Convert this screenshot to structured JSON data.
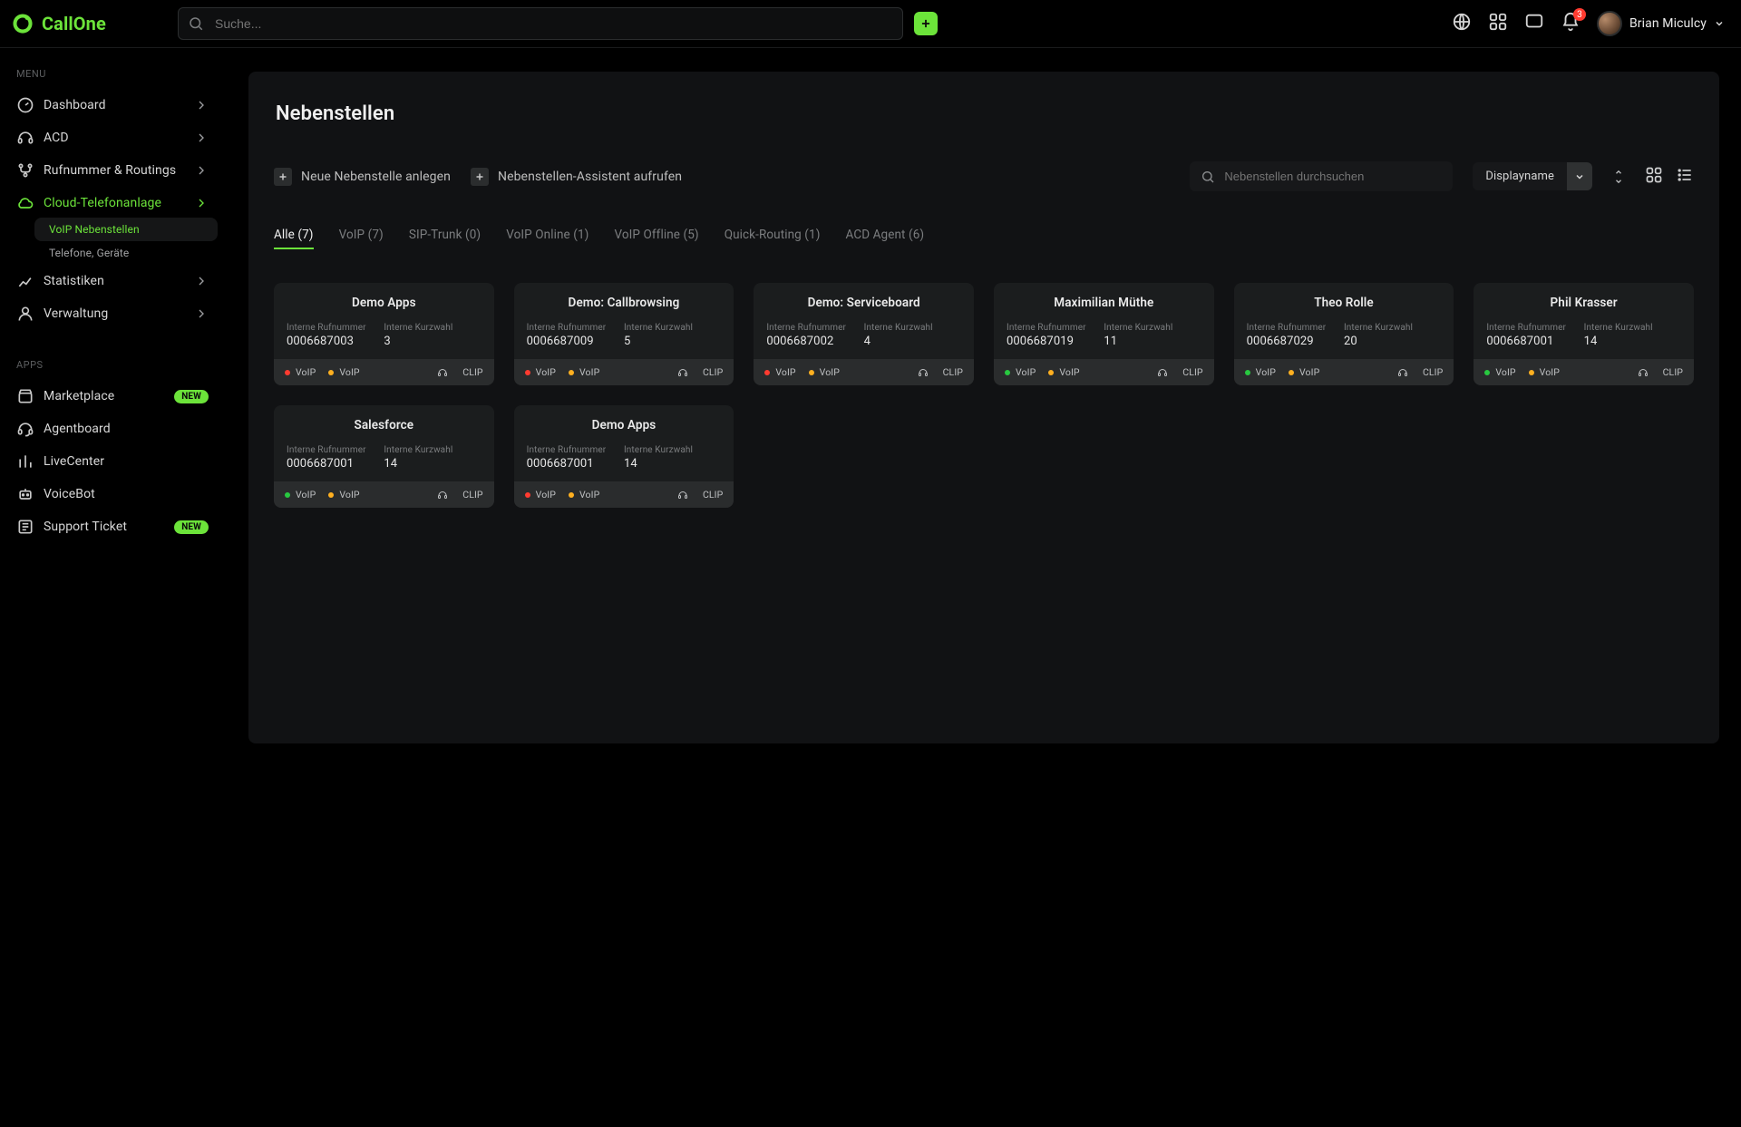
{
  "brand": {
    "name": "CallOne"
  },
  "search": {
    "placeholder": "Suche..."
  },
  "user": {
    "name": "Brian Miculcy"
  },
  "notifications": {
    "count": "3"
  },
  "sidebar": {
    "menuLabel": "MENU",
    "appsLabel": "APPS",
    "items": [
      {
        "label": "Dashboard"
      },
      {
        "label": "ACD"
      },
      {
        "label": "Rufnummer & Routings"
      },
      {
        "label": "Cloud-Telefonanlage"
      },
      {
        "label": "Statistiken"
      },
      {
        "label": "Verwaltung"
      }
    ],
    "subItems": [
      {
        "label": "VoIP Nebenstellen"
      },
      {
        "label": "Telefone, Geräte"
      }
    ],
    "apps": [
      {
        "label": "Marketplace",
        "badge": "NEW"
      },
      {
        "label": "Agentboard"
      },
      {
        "label": "LiveCenter"
      },
      {
        "label": "VoiceBot"
      },
      {
        "label": "Support Ticket",
        "badge": "NEW"
      }
    ]
  },
  "page": {
    "title": "Nebenstellen",
    "actions": {
      "new": "Neue Nebenstelle anlegen",
      "assistant": "Nebenstellen-Assistent aufrufen"
    },
    "filterSearchPlaceholder": "Nebenstellen durchsuchen",
    "sortLabel": "Displayname"
  },
  "labels": {
    "intNumber": "Interne Rufnummer",
    "intShort": "Interne Kurzwahl",
    "voip": "VoIP",
    "clip": "CLIP"
  },
  "tabs": [
    {
      "label": "Alle (7)",
      "active": true
    },
    {
      "label": "VoIP (7)"
    },
    {
      "label": "SIP-Trunk (0)"
    },
    {
      "label": "VoIP Online (1)"
    },
    {
      "label": "VoIP Offline (5)"
    },
    {
      "label": "Quick-Routing (1)"
    },
    {
      "label": "ACD Agent (6)"
    }
  ],
  "cards": [
    {
      "name": "Demo Apps",
      "number": "0006687003",
      "short": "3",
      "voip1": "red",
      "voip2": "amber"
    },
    {
      "name": "Demo: Callbrowsing",
      "number": "0006687009",
      "short": "5",
      "voip1": "red",
      "voip2": "amber"
    },
    {
      "name": "Demo: Serviceboard",
      "number": "0006687002",
      "short": "4",
      "voip1": "red",
      "voip2": "amber"
    },
    {
      "name": "Maximilian Müthe",
      "number": "0006687019",
      "short": "11",
      "voip1": "green",
      "voip2": "amber"
    },
    {
      "name": "Theo Rolle",
      "number": "0006687029",
      "short": "20",
      "voip1": "green",
      "voip2": "amber"
    },
    {
      "name": "Phil Krasser",
      "number": "0006687001",
      "short": "14",
      "voip1": "green",
      "voip2": "amber"
    },
    {
      "name": "Salesforce",
      "number": "0006687001",
      "short": "14",
      "voip1": "green",
      "voip2": "amber"
    },
    {
      "name": "Demo Apps",
      "number": "0006687001",
      "short": "14",
      "voip1": "red",
      "voip2": "amber"
    }
  ]
}
